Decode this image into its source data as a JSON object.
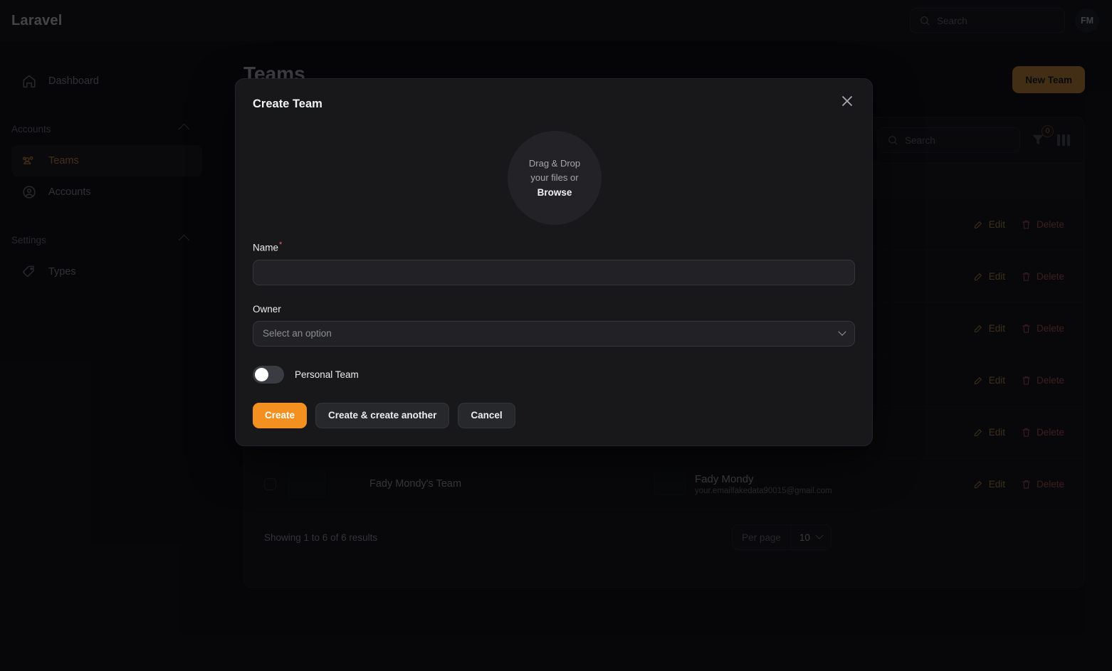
{
  "topbar": {
    "brand": "Laravel",
    "search_placeholder": "Search",
    "avatar_initials": "FM"
  },
  "sidebar": {
    "dashboard": {
      "label": "Dashboard",
      "icon": "home-icon"
    },
    "groups": [
      {
        "label": "Accounts",
        "items": [
          {
            "label": "Teams",
            "icon": "users-group-icon",
            "active": true
          },
          {
            "label": "Accounts",
            "icon": "user-circle-icon",
            "active": false
          }
        ]
      },
      {
        "label": "Settings",
        "items": [
          {
            "label": "Types",
            "icon": "tag-icon",
            "active": false
          }
        ]
      }
    ]
  },
  "main": {
    "page_title": "Teams",
    "new_button": "New Team",
    "table_search_placeholder": "Search",
    "filter_badge": "0",
    "rows": [
      {
        "name": "",
        "owner_name": "",
        "owner_email": "",
        "edit": "Edit",
        "delete": "Delete"
      },
      {
        "name": "",
        "owner_name": "",
        "owner_email": "",
        "edit": "Edit",
        "delete": "Delete"
      },
      {
        "name": "",
        "owner_name": "",
        "owner_email": "",
        "edit": "Edit",
        "delete": "Delete"
      },
      {
        "name": "",
        "owner_name": "",
        "owner_email": "",
        "edit": "Edit",
        "delete": "Delete"
      },
      {
        "name": "",
        "owner_name": "",
        "owner_email": "",
        "edit": "Edit",
        "delete": "Delete"
      },
      {
        "name": "Fady Mondy's Team",
        "owner_name": "Fady Mondy",
        "owner_email": "your.emailfakedata90015@gmail.com",
        "edit": "Edit",
        "delete": "Delete"
      }
    ],
    "footer": {
      "showing": "Showing 1 to 6 of 6 results",
      "per_page_label": "Per page",
      "per_page_value": "10"
    }
  },
  "modal": {
    "title": "Create Team",
    "close_icon": "close-icon",
    "dropzone": {
      "line1": "Drag & Drop",
      "line2": "your files or",
      "browse": "Browse"
    },
    "fields": {
      "name_label": "Name",
      "name_required_mark": "*",
      "name_value": "",
      "owner_label": "Owner",
      "owner_placeholder": "Select an option",
      "toggle_label": "Personal Team"
    },
    "buttons": {
      "create": "Create",
      "create_another": "Create & create another",
      "cancel": "Cancel"
    }
  },
  "colors": {
    "accent": "#f0a43a",
    "primary_button": "#f49020",
    "danger": "#d86060",
    "page_bg": "#0b0b0d",
    "modal_bg": "#18181b"
  }
}
